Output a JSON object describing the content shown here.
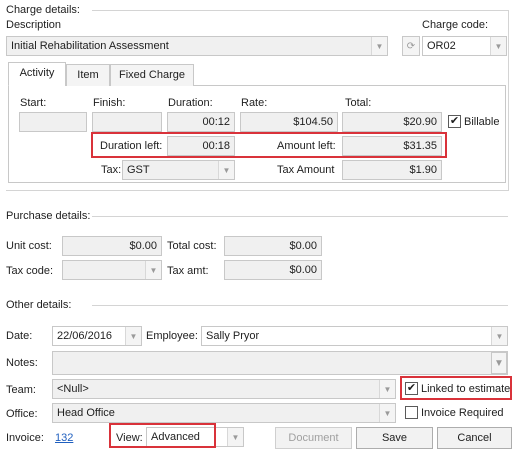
{
  "charge": {
    "section_title": "Charge details:",
    "description_label": "Description",
    "description_value": "Initial Rehabilitation Assessment",
    "charge_code_label": "Charge code:",
    "charge_code_value": "OR02"
  },
  "tabs": [
    {
      "label": "Activity"
    },
    {
      "label": "Item"
    },
    {
      "label": "Fixed Charge"
    }
  ],
  "activity": {
    "start_label": "Start:",
    "start_value": "",
    "finish_label": "Finish:",
    "finish_value": "",
    "duration_label": "Duration:",
    "duration_value": "00:12",
    "rate_label": "Rate:",
    "rate_value": "$104.50",
    "total_label": "Total:",
    "total_value": "$20.90",
    "billable_label": "Billable",
    "duration_left_label": "Duration left:",
    "duration_left_value": "00:18",
    "amount_left_label": "Amount left:",
    "amount_left_value": "$31.35",
    "tax_label": "Tax:",
    "tax_value": "GST",
    "tax_amount_label": "Tax Amount",
    "tax_amount_value": "$1.90"
  },
  "purchase": {
    "section_title": "Purchase details:",
    "unit_cost_label": "Unit cost:",
    "unit_cost_value": "$0.00",
    "total_cost_label": "Total cost:",
    "total_cost_value": "$0.00",
    "tax_code_label": "Tax code:",
    "tax_code_value": "",
    "tax_amt_label": "Tax amt:",
    "tax_amt_value": "$0.00"
  },
  "other": {
    "section_title": "Other details:",
    "date_label": "Date:",
    "date_value": "22/06/2016",
    "employee_label": "Employee:",
    "employee_value": "Sally Pryor",
    "notes_label": "Notes:",
    "notes_value": "",
    "team_label": "Team:",
    "team_value": "<Null>",
    "linked_label": "Linked to estimate",
    "office_label": "Office:",
    "office_value": "Head Office",
    "invoice_required_label": "Invoice Required",
    "invoice_label": "Invoice:",
    "invoice_value": "132",
    "view_label": "View:",
    "view_value": "Advanced"
  },
  "buttons": {
    "document": "Document",
    "save": "Save",
    "cancel": "Cancel"
  },
  "icons": {
    "dropdown": "chevron-down-icon",
    "refresh": "refresh-icon",
    "checkmark": "checkmark-icon"
  },
  "colors": {
    "highlight": "#d9323a",
    "link": "#1f5fbf"
  }
}
